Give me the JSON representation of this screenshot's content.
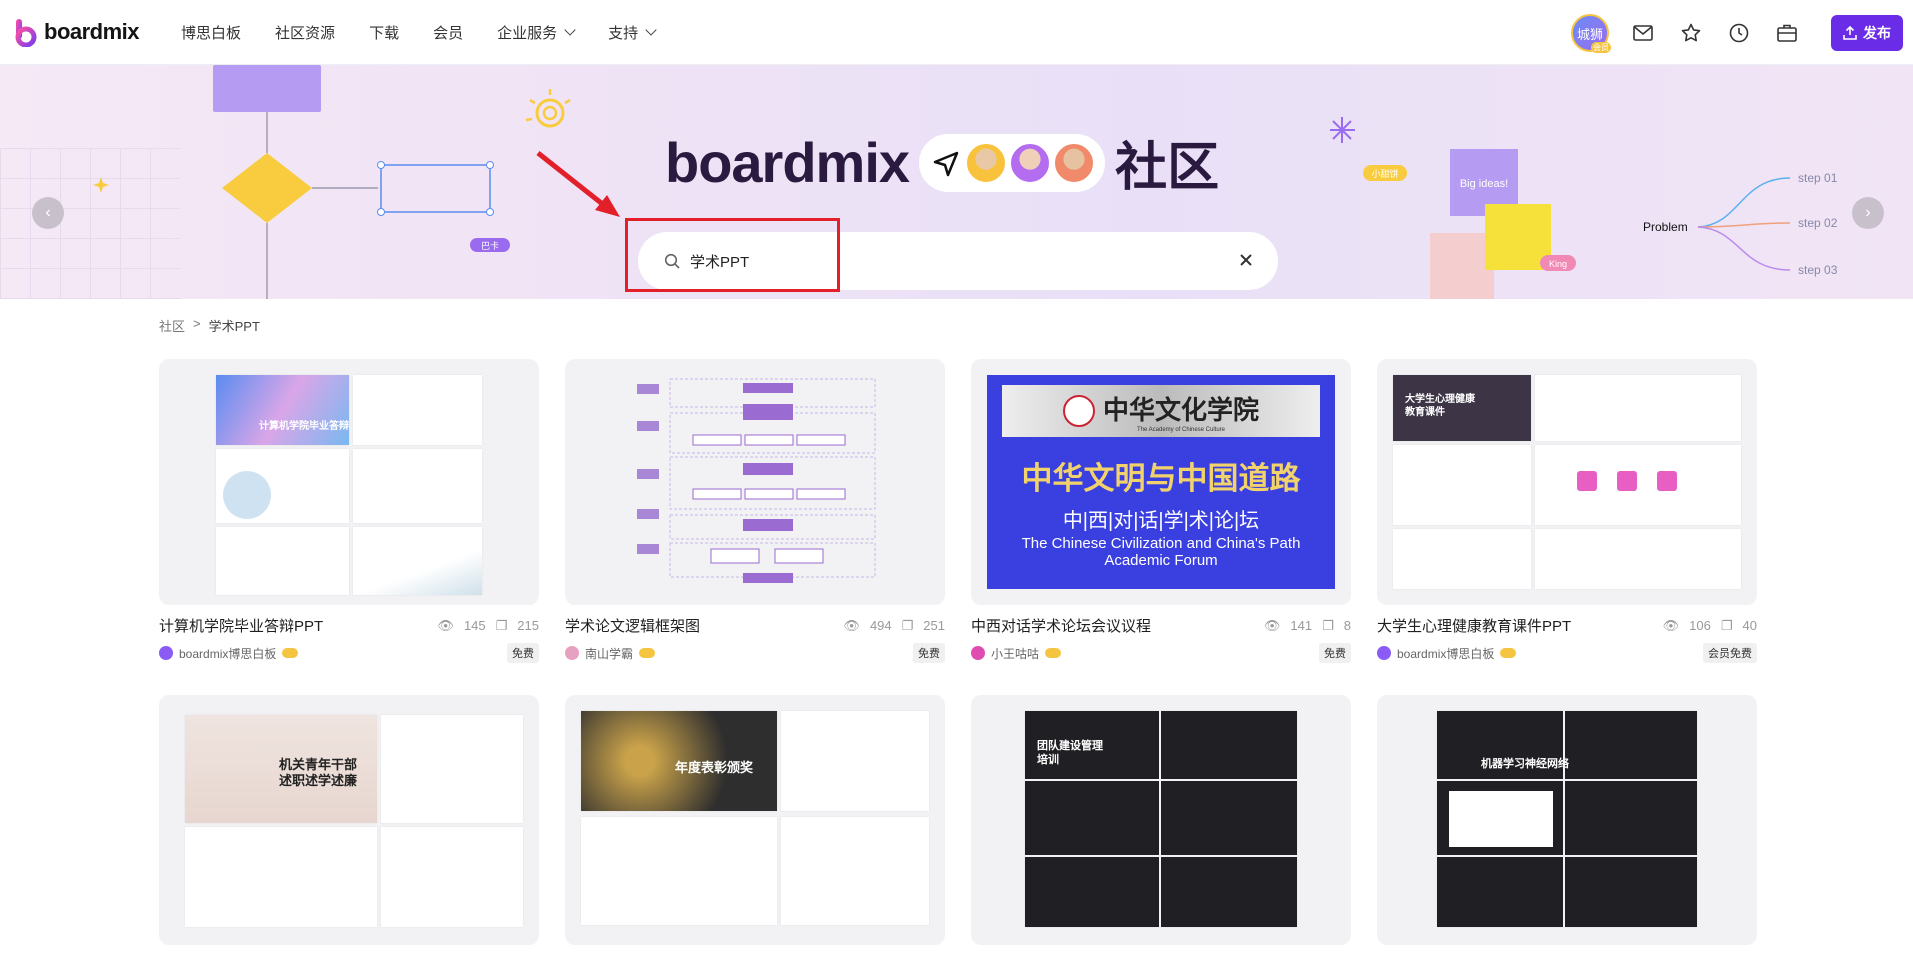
{
  "header": {
    "logo_text": "boardmix",
    "nav": [
      {
        "label": "博思白板",
        "dropdown": false
      },
      {
        "label": "社区资源",
        "dropdown": false
      },
      {
        "label": "下载",
        "dropdown": false
      },
      {
        "label": "会员",
        "dropdown": false
      },
      {
        "label": "企业服务",
        "dropdown": true
      },
      {
        "label": "支持",
        "dropdown": true
      }
    ],
    "avatar_label": "城狮",
    "avatar_badge": "会员",
    "publish_label": "发布"
  },
  "hero": {
    "brand": "boardmix",
    "community": "社区",
    "search_value": "学术PPT",
    "deco_labels": {
      "bijia": "巴卡",
      "xiaotang": "小甜饼",
      "big_ideas": "Big ideas!",
      "king": "King",
      "problem": "Problem",
      "step1": "step 01",
      "step2": "step 02",
      "step3": "step 03"
    }
  },
  "breadcrumb": {
    "root": "社区",
    "sep": ">",
    "current": "学术PPT"
  },
  "cards": [
    {
      "title": "计算机学院毕业答辩PPT",
      "views": "145",
      "copies": "215",
      "author": "boardmix博思白板",
      "tag": "免费",
      "thumb_text": "计算机学院毕业答辩",
      "author_color": "#8a5cf5"
    },
    {
      "title": "学术论文逻辑框架图",
      "views": "494",
      "copies": "251",
      "author": "南山学霸",
      "tag": "免费",
      "thumb_text": "",
      "author_color": "#e8a0c0"
    },
    {
      "title": "中西对话学术论坛会议议程",
      "views": "141",
      "copies": "8",
      "author": "小王咕咕",
      "tag": "免费",
      "thumb_text": "中华文明与中国道路",
      "author_color": "#e04db0"
    },
    {
      "title": "大学生心理健康教育课件PPT",
      "views": "106",
      "copies": "40",
      "author": "boardmix博思白板",
      "tag": "会员免费",
      "thumb_text": "大学生心理健康教育课件",
      "author_color": "#8a5cf5"
    }
  ],
  "forum_thumb": {
    "school": "中华文化学院",
    "school_en": "The Academy of Chinese Culture",
    "sub": "中|西|对|话|学|术|论|坛",
    "en1": "The Chinese Civilization and China's Path",
    "en2": "Academic Forum"
  },
  "cards_row2": [
    {
      "thumb_text": "机关青年干部述职述学述廉"
    },
    {
      "thumb_text": "年度表彰颁奖"
    },
    {
      "thumb_text": "团队建设管理培训"
    },
    {
      "thumb_text": "机器学习神经网络"
    }
  ],
  "colors": {
    "accent": "#6b2ce8",
    "red_box": "#e3202a",
    "forum_blue": "#3a3fe0",
    "forum_gold": "#f2d36b"
  }
}
